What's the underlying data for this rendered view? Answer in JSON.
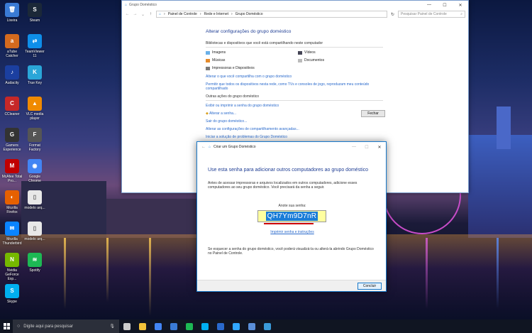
{
  "desktop": {
    "icons": [
      {
        "label": "Lixeira",
        "color": "#3a7bd5",
        "glyph": "🗑"
      },
      {
        "label": "Steam",
        "color": "#1b2838",
        "glyph": "S"
      },
      {
        "label": "aTube Catcher",
        "color": "#d46a1e",
        "glyph": "a"
      },
      {
        "label": "TeamViewer 11",
        "color": "#0e8ee9",
        "glyph": "⇄"
      },
      {
        "label": "Audacity",
        "color": "#1b3fa0",
        "glyph": "♪"
      },
      {
        "label": "True Key",
        "color": "#2aa6d8",
        "glyph": "K"
      },
      {
        "label": "CCleaner",
        "color": "#c62828",
        "glyph": "C"
      },
      {
        "label": "VLC media player",
        "color": "#f08a00",
        "glyph": "▲"
      },
      {
        "label": "Gamers Experience",
        "color": "#333333",
        "glyph": "G"
      },
      {
        "label": "Format Factory",
        "color": "#555555",
        "glyph": "F"
      },
      {
        "label": "McAfee Total Pro...",
        "color": "#c00000",
        "glyph": "M"
      },
      {
        "label": "Google Chrome",
        "color": "#4285f4",
        "glyph": "◉"
      },
      {
        "label": "Mozilla Firefox",
        "color": "#e66000",
        "glyph": "◐"
      },
      {
        "label": "modelo arq...",
        "color": "#e8e8e8",
        "glyph": "▯"
      },
      {
        "label": "Mozilla Thunderbird",
        "color": "#0a84ff",
        "glyph": "✉"
      },
      {
        "label": "modelo arq...",
        "color": "#e8e8e8",
        "glyph": "▯"
      },
      {
        "label": "Nvidia GeForce Exp...",
        "color": "#76b900",
        "glyph": "N"
      },
      {
        "label": "Spotify",
        "color": "#1db954",
        "glyph": "≋"
      },
      {
        "label": "Skype",
        "color": "#00aff0",
        "glyph": "S"
      }
    ]
  },
  "explorer": {
    "title": "Grupo Doméstico",
    "breadcrumb": [
      "Painel de Controle",
      "Rede e Internet",
      "Grupo Doméstico"
    ],
    "search_placeholder": "Pesquisar Painel de Controle",
    "heading": "Alterar configurações do grupo doméstico",
    "libraries_header": "Bibliotecas e dispositivos que você está compartilhando neste computador",
    "libraries": [
      "Imagens",
      "Vídeos",
      "Músicas",
      "Documentos",
      "Impressoras e Dispositivos"
    ],
    "links_top": [
      "Alterar o que você compartilha com o grupo doméstico",
      "Permitir que todos os dispositivos nesta rede, como TVs e consoles de jogo, reproduzam meu conteúdo compartilhado"
    ],
    "other_header": "Outras ações do grupo doméstico",
    "links_other": [
      "Exibir ou imprimir a senha do grupo doméstico",
      "Alterar a senha...",
      "Sair do grupo doméstico...",
      "Alterar as configurações de compartilhamento avançadas...",
      "Iniciar a solução de problemas do Grupo Doméstico"
    ],
    "close_button": "Fechar"
  },
  "dialog": {
    "title": "Criar um Grupo Doméstico",
    "heading": "Use esta senha para adicionar outros computadores ao grupo doméstico",
    "paragraph": "Antes de acessar impressoras e arquivos localizados em outros computadores, adicione esses computadores ao seu grupo doméstico. Você precisará da senha a seguir.",
    "password_label": "Anote sua senha:",
    "password": "QH7Ym9D7nR",
    "print_link": "Imprimir senha e instruções",
    "footer_text": "Se esquecer a senha do grupo doméstico, você poderá visualizá-la ou alterá-la abrindo Grupo Doméstico no Painel de Controle.",
    "finish_button": "Concluir"
  },
  "taskbar": {
    "search_placeholder": "Digite aqui para pesquisar",
    "apps": [
      {
        "name": "task-view",
        "color": "#cccccc"
      },
      {
        "name": "file-explorer",
        "color": "#f3c33a"
      },
      {
        "name": "chrome",
        "color": "#4285f4"
      },
      {
        "name": "store",
        "color": "#3a7bd5"
      },
      {
        "name": "spotify",
        "color": "#1db954"
      },
      {
        "name": "skype",
        "color": "#00aff0"
      },
      {
        "name": "photos",
        "color": "#2a6acc"
      },
      {
        "name": "photoshop",
        "color": "#31a8ff"
      },
      {
        "name": "control-panel",
        "color": "#5a8fd8"
      },
      {
        "name": "homegroup",
        "color": "#3a9ad9"
      }
    ]
  }
}
